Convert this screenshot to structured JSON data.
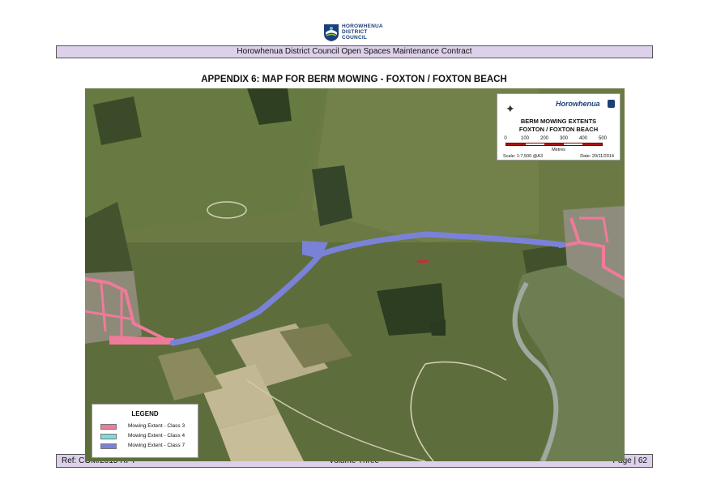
{
  "header": {
    "logo_text": [
      "HOROWHENUA",
      "DISTRICT",
      "COUNCIL"
    ],
    "banner": "Horowhenua District Council Open Spaces Maintenance Contract"
  },
  "appendix": {
    "title": "APPENDIX 6:   MAP FOR BERM MOWING - FOXTON / FOXTON BEACH"
  },
  "map": {
    "brand": "Horowhenua",
    "title_line1": "BERM MOWING EXTENTS",
    "title_line2": "FOXTON / FOXTON BEACH",
    "scale_ticks": [
      "0",
      "100",
      "200",
      "300",
      "400",
      "500"
    ],
    "scale_units": "Metres",
    "scale_ratio": "Scale: 1:7,500 @A3",
    "date": "Date: 20/11/2014",
    "scale_bar_colors": [
      "#b01010",
      "#ffffff",
      "#b01010",
      "#ffffff",
      "#b01010"
    ],
    "legend": {
      "title": "LEGEND",
      "items": [
        {
          "label": "Mowing Extent - Class 3",
          "color": "#f07a9a"
        },
        {
          "label": "Mowing Extent - Class 4",
          "color": "#7fdcd8"
        },
        {
          "label": "Mowing Extent - Class 7",
          "color": "#7a82d8"
        }
      ]
    }
  },
  "footer": {
    "ref": "Ref: COM/2015 RFT",
    "volume": "Volume Three",
    "page": "Page | 62"
  }
}
